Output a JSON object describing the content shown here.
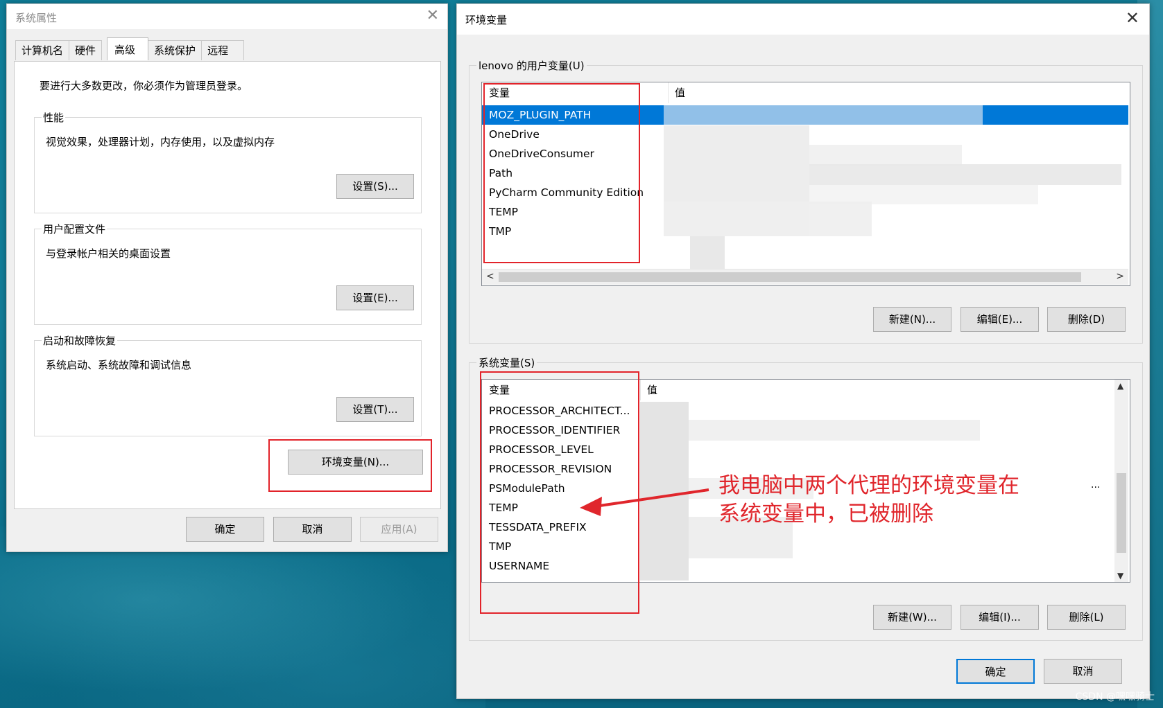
{
  "system_properties": {
    "title": "系统属性",
    "close_glyph": "✕",
    "tabs": [
      {
        "label": "计算机名"
      },
      {
        "label": "硬件"
      },
      {
        "label": "高级"
      },
      {
        "label": "系统保护"
      },
      {
        "label": "远程"
      }
    ],
    "active_tab": "高级",
    "admin_note": "要进行大多数更改，你必须作为管理员登录。",
    "performance": {
      "label": "性能",
      "desc": "视觉效果，处理器计划，内存使用，以及虚拟内存",
      "button": "设置(S)..."
    },
    "user_profile": {
      "label": "用户配置文件",
      "desc": "与登录帐户相关的桌面设置",
      "button": "设置(E)..."
    },
    "startup_recovery": {
      "label": "启动和故障恢复",
      "desc": "系统启动、系统故障和调试信息",
      "button": "设置(T)..."
    },
    "env_button": "环境变量(N)...",
    "ok": "确定",
    "cancel": "取消",
    "apply": "应用(A)"
  },
  "env_vars": {
    "title": "环境变量",
    "close_glyph": "✕",
    "user_section": {
      "label": "lenovo 的用户变量(U)",
      "col_var": "变量",
      "col_val": "值",
      "rows": [
        "MOZ_PLUGIN_PATH",
        "OneDrive",
        "OneDriveConsumer",
        "Path",
        "PyCharm Community Edition",
        "TEMP",
        "TMP"
      ],
      "selected": "MOZ_PLUGIN_PATH",
      "new": "新建(N)...",
      "edit": "编辑(E)...",
      "delete": "删除(D)"
    },
    "system_section": {
      "label": "系统变量(S)",
      "col_var": "变量",
      "col_val": "值",
      "rows": [
        "PROCESSOR_ARCHITECT...",
        "PROCESSOR_IDENTIFIER",
        "PROCESSOR_LEVEL",
        "PROCESSOR_REVISION",
        "PSModulePath",
        "TEMP",
        "TESSDATA_PREFIX",
        "TMP",
        "USERNAME"
      ],
      "value_ellipsis": "...",
      "new": "新建(W)...",
      "edit": "编辑(I)...",
      "delete": "删除(L)"
    },
    "ok": "确定",
    "cancel": "取消"
  },
  "annotation": {
    "line1": "我电脑中两个代理的环境变量在",
    "line2": "系统变量中，已被删除",
    "color": "#e0262c"
  },
  "watermark": "CSDN @嘿嘿骑士",
  "colors": {
    "selection": "#0078d7",
    "highlight_box": "#e2232a"
  }
}
